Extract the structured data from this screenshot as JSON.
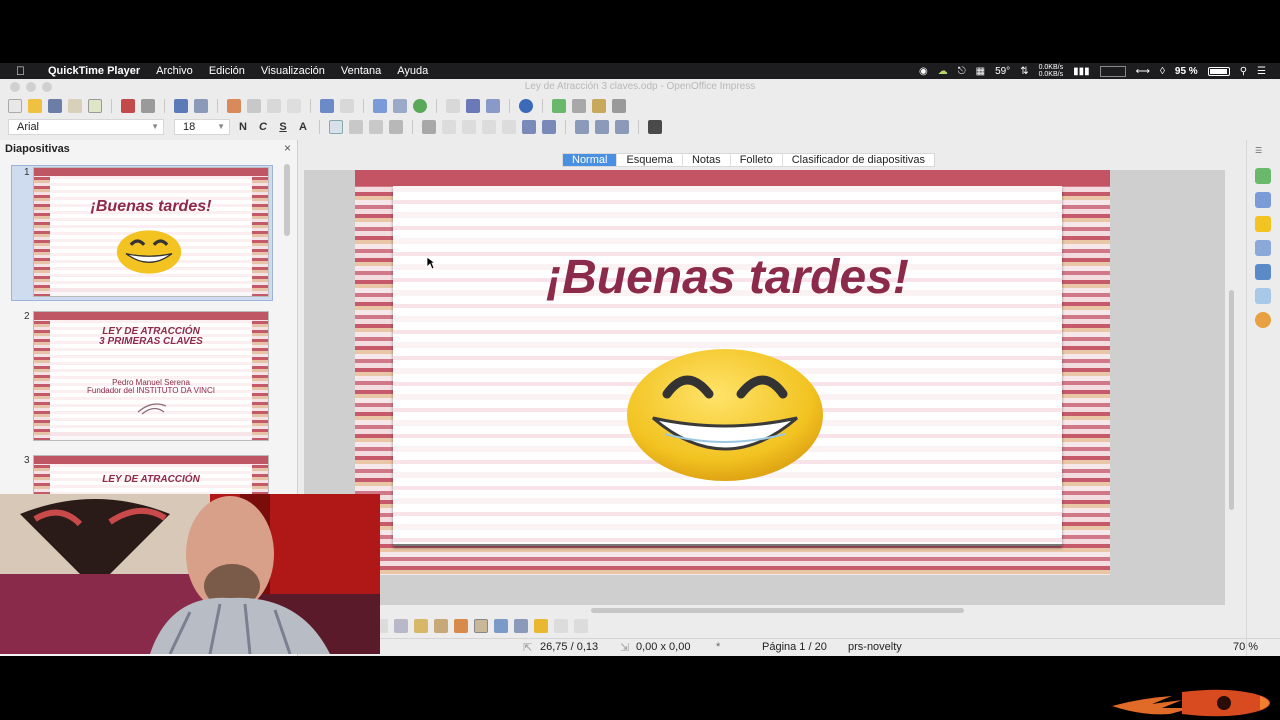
{
  "menubar": {
    "app": "QuickTime Player",
    "items": [
      "Archivo",
      "Edición",
      "Visualización",
      "Ventana",
      "Ayuda"
    ],
    "temperature": "59°",
    "net_up": "0.0KB/s",
    "net_down": "0.0KB/s",
    "battery": "95 %"
  },
  "window": {
    "title": "Ley de Atracción 3 claves.odp - OpenOffice Impress"
  },
  "format": {
    "font": "Arial",
    "size": "18",
    "bold": "N",
    "italic": "C",
    "underline": "S"
  },
  "panel": {
    "title": "Diapositivas",
    "close": "×",
    "slides": [
      {
        "num": "1",
        "title": "¡Buenas tardes!"
      },
      {
        "num": "2",
        "title_line1": "LEY DE ATRACCIÓN",
        "title_line2": "3 PRIMERAS CLAVES",
        "sub_line1": "Pedro Manuel Serena",
        "sub_line2": "Fundador del INSTITUTO DA VINCI"
      },
      {
        "num": "3",
        "title": "LEY DE ATRACCIÓN"
      }
    ]
  },
  "tabs": [
    "Normal",
    "Esquema",
    "Notas",
    "Folleto",
    "Clasificador de diapositivas"
  ],
  "active_tab": "Normal",
  "slide": {
    "title": "¡Buenas tardes!"
  },
  "status": {
    "position": "26,75 / 0,13",
    "size": "0,00 x 0,00",
    "page": "Página 1 / 20",
    "layout": "prs-novelty",
    "zoom": "70 %"
  }
}
